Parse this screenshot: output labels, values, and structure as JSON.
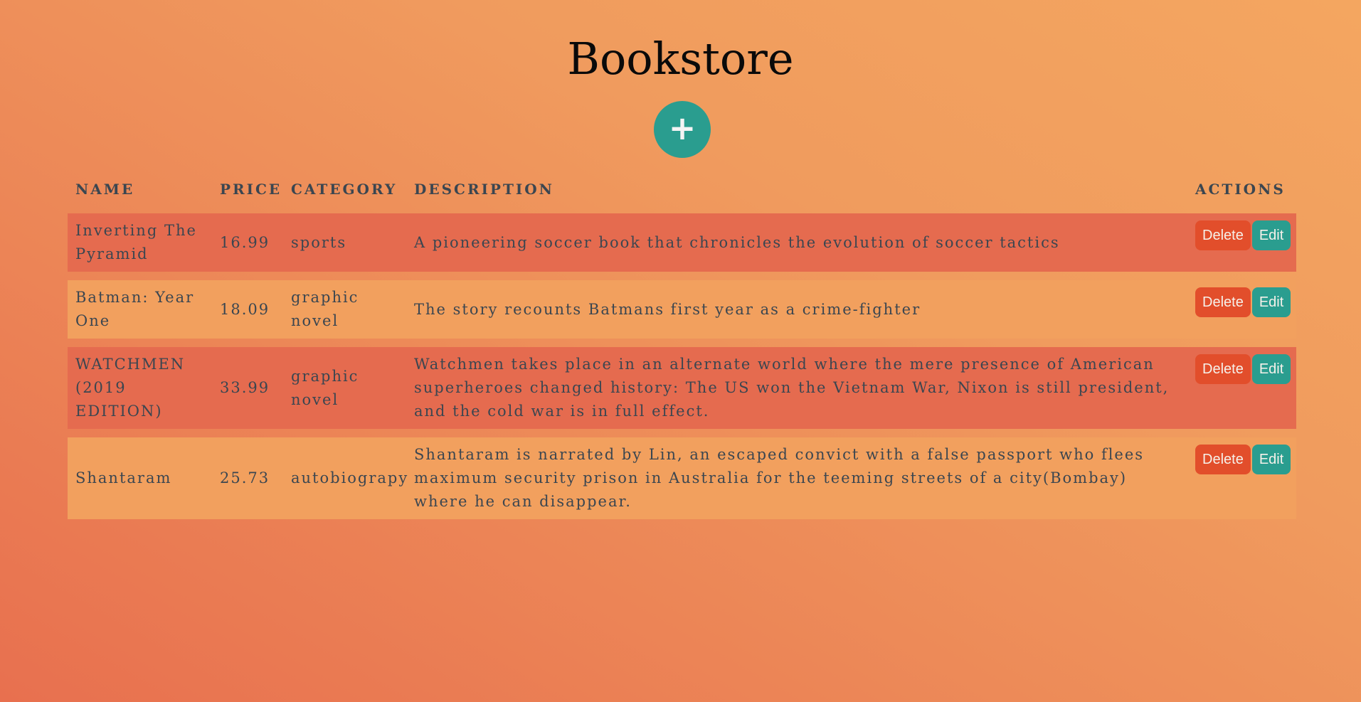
{
  "page": {
    "title": "Bookstore",
    "add_label": "+"
  },
  "table": {
    "headers": {
      "name": "NAME",
      "price": "PRICE",
      "category": "CATEGORY",
      "description": "DESCRIPTION",
      "actions": "ACTIONS"
    },
    "rows": [
      {
        "name": "Inverting The Pyramid",
        "price": "16.99",
        "category": "sports",
        "description": "A pioneering soccer book that chronicles the evolution of soccer tactics",
        "delete_label": "Delete",
        "edit_label": "Edit"
      },
      {
        "name": "Batman: Year One",
        "price": "18.09",
        "category": "graphic novel",
        "description": "The story recounts Batmans first year as a crime-fighter",
        "delete_label": "Delete",
        "edit_label": "Edit"
      },
      {
        "name": "WATCHMEN (2019 EDITION)",
        "price": "33.99",
        "category": "graphic novel",
        "description": "Watchmen takes place in an alternate world where the mere presence of American superheroes changed history: The US won the Vietnam War, Nixon is still president, and the cold war is in full effect.",
        "delete_label": "Delete",
        "edit_label": "Edit"
      },
      {
        "name": "Shantaram",
        "price": "25.73",
        "category": "autobiograpy",
        "description": "Shantaram is narrated by Lin, an escaped convict with a false passport who flees maximum security prison in Australia for the teeming streets of a city(Bombay) where he can disappear.",
        "delete_label": "Delete",
        "edit_label": "Edit"
      }
    ]
  },
  "colors": {
    "accent_teal": "#2a9d8f",
    "delete_red": "#e24e2b",
    "row_odd": "#e56b4f",
    "row_even": "#f2a05e"
  },
  "icons": {
    "add": "plus-icon"
  }
}
